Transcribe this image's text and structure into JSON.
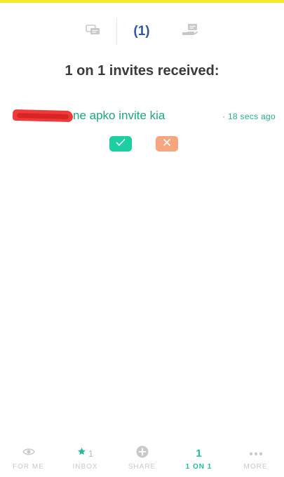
{
  "colors": {
    "accent_bar": "#f2ea2a",
    "tab_active": "#2f57a6",
    "green": "#1aa77d",
    "accept": "#1ccfa0",
    "reject": "#f7a57e",
    "nav_inactive": "#c9c9c9",
    "nav_active": "#1ebf9a"
  },
  "top_tabs": {
    "chats_icon": "chat-bubbles-icon",
    "invites_count": "(1)",
    "requests_icon": "hand-request-icon"
  },
  "heading": "1 on 1 invites received:",
  "invites": [
    {
      "sender_redacted": true,
      "message": "ne apko invite kia",
      "time": "· 18 secs ago",
      "accept_icon": "check-icon",
      "reject_icon": "close-icon"
    }
  ],
  "bottom_nav": [
    {
      "label": "FOR ME",
      "icon": "eye-icon",
      "active": false
    },
    {
      "label": "INBOX",
      "icon": "star-icon",
      "count": "1",
      "active": false
    },
    {
      "label": "SHARE",
      "icon": "plus-circle-icon",
      "active": false
    },
    {
      "label": "1 ON 1",
      "count": "1",
      "active": true
    },
    {
      "label": "MORE",
      "icon": "more-dots-icon",
      "active": false
    }
  ]
}
